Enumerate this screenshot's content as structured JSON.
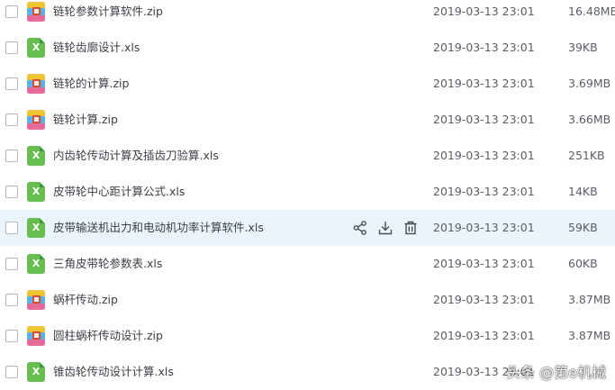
{
  "files": [
    {
      "name": "链轮参数计算软件.zip",
      "type": "zip",
      "date": "2019-03-13 23:01",
      "size": "16.48MB"
    },
    {
      "name": "链轮齿廓设计.xls",
      "type": "xls",
      "date": "2019-03-13 23:01",
      "size": "39KB"
    },
    {
      "name": "链轮的计算.zip",
      "type": "zip",
      "date": "2019-03-13 23:01",
      "size": "3.69MB"
    },
    {
      "name": "链轮计算.zip",
      "type": "zip",
      "date": "2019-03-13 23:01",
      "size": "3.66MB"
    },
    {
      "name": "内齿轮传动计算及插齿刀验算.xls",
      "type": "xls",
      "date": "2019-03-13 23:01",
      "size": "251KB"
    },
    {
      "name": "皮带轮中心距计算公式.xls",
      "type": "xls",
      "date": "2019-03-13 23:01",
      "size": "14KB"
    },
    {
      "name": "皮带输送机出力和电动机功率计算软件.xls",
      "type": "xls",
      "date": "2019-03-13 23:01",
      "size": "59KB",
      "hovered": true
    },
    {
      "name": "三角皮带轮参数表.xls",
      "type": "xls",
      "date": "2019-03-13 23:01",
      "size": "60KB"
    },
    {
      "name": "蜗杆传动.zip",
      "type": "zip",
      "date": "2019-03-13 23:01",
      "size": "3.87MB"
    },
    {
      "name": "圆柱蜗杆传动设计.zip",
      "type": "zip",
      "date": "2019-03-13 23:01",
      "size": "3.87MB"
    },
    {
      "name": "锥齿轮传动设计计算.xls",
      "type": "xls",
      "date": "2019-03-13 23:01",
      "size": "-"
    }
  ],
  "xls_icon_letter": "X",
  "row_actions": [
    "share-icon",
    "download-icon",
    "delete-icon"
  ],
  "colors": {
    "hover_row": "#e9f4fd",
    "xls_icon": "#67bd4f",
    "text": "#3b3f45",
    "meta_text": "#5a5f66"
  },
  "watermark": "头条 @第e机械"
}
